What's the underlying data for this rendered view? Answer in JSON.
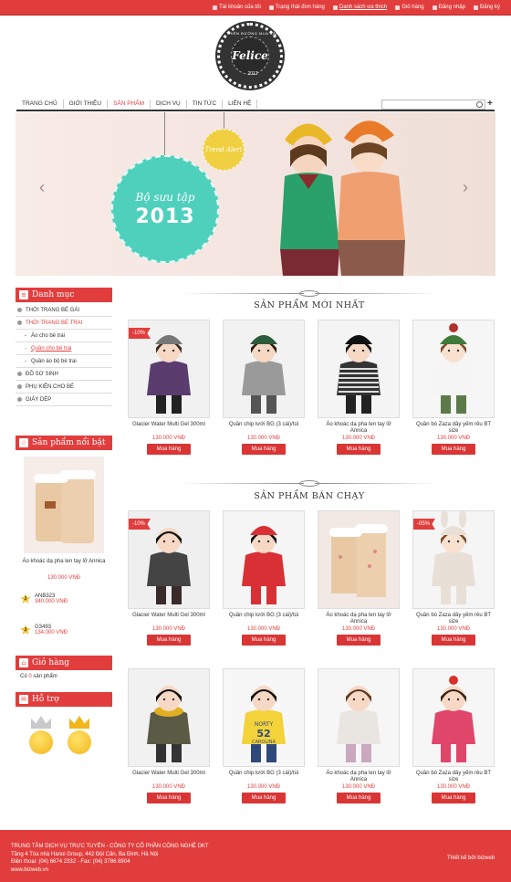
{
  "topbar": {
    "links": [
      "Tài khoản của tôi",
      "Trạng thái đơn hàng",
      "Danh sách ưa thích",
      "Giỏ hàng",
      "Đăng nhập",
      "Đăng ký"
    ],
    "active_index": 2
  },
  "logo": {
    "brand": "Felice",
    "top_text": "THIÊN ĐƯỜNG MUA SẮM",
    "year": "2012"
  },
  "nav": {
    "items": [
      "TRANG CHỦ",
      "GIỚI THIỆU",
      "SẢN PHẨM",
      "DỊCH VỤ",
      "TIN TỨC",
      "LIÊN HỆ"
    ],
    "active_index": 2
  },
  "banner": {
    "circle_line1": "Bộ sưu tập",
    "circle_line2": "2013",
    "tag_text": "Trend Alert"
  },
  "sidebar": {
    "category_title": "Danh mục",
    "categories": [
      {
        "label": "THỜI TRANG BÉ GÁI",
        "level": 0
      },
      {
        "label": "THỜI TRANG BÉ TRAI",
        "level": 0,
        "active": true
      },
      {
        "label": "Áo cho bé trai",
        "level": 1
      },
      {
        "label": "Quần cho bé trai",
        "level": 1,
        "active": true
      },
      {
        "label": "Quần áo bộ bé trai",
        "level": 1
      },
      {
        "label": "ĐỒ SƠ SINH",
        "level": 0
      },
      {
        "label": "PHỤ KIỆN CHO BÉ",
        "level": 0
      },
      {
        "label": "GIÀY DÉP",
        "level": 0
      }
    ],
    "featured_title": "Sản phẩm nổi bật",
    "featured": {
      "name": "Áo khoác dạ pha len tay lỡ Annica",
      "price": "130.000 VNĐ"
    },
    "ranks": [
      {
        "rank": "2",
        "code": "ANB323",
        "price": "340.000 VNĐ"
      },
      {
        "rank": "3",
        "code": "G3493",
        "price": "134.000 VNĐ"
      }
    ],
    "cart_title": "Giỏ hàng",
    "cart_prefix": "Có",
    "cart_count": "0",
    "cart_suffix": "sản phẩm",
    "support_title": "Hỗ trợ"
  },
  "sections": {
    "new_title": "SẢN PHẨM MỚI NHẤT",
    "best_title": "SẢN PHẨM BÁN CHẠY"
  },
  "buy_label": "Mua hàng",
  "new_products": [
    {
      "name": "Glacier Water Multi Gel 300ml",
      "price": "130.000 VNĐ",
      "badge": "-10%"
    },
    {
      "name": "Quần chip lưới BG (3 cái)/túi",
      "price": "130.000 VNĐ",
      "badge": ""
    },
    {
      "name": "Áo khoác dạ pha len tay lỡ Annica",
      "price": "130.000 VNĐ",
      "badge": ""
    },
    {
      "name": "Quần bó Zaza dây yếm rêu BT size",
      "price": "130.000 VNĐ",
      "badge": ""
    }
  ],
  "best_products": [
    {
      "name": "Glacier Water Multi Gel 300ml",
      "price": "130.000 VNĐ",
      "badge": "-10%"
    },
    {
      "name": "Quần chip lưới BG (3 cái)/túi",
      "price": "130.000 VNĐ",
      "badge": ""
    },
    {
      "name": "Áo khoác dạ pha len tay lỡ Annica",
      "price": "130.000 VNĐ",
      "badge": ""
    },
    {
      "name": "Quần bó Zaza dây yếm rêu BT size",
      "price": "130.000 VNĐ",
      "badge": "-05%"
    },
    {
      "name": "Glacier Water Multi Gel 300ml",
      "price": "130.000 VNĐ",
      "badge": ""
    },
    {
      "name": "Quần chip lưới BG (3 cái)/túi",
      "price": "130.000 VNĐ",
      "badge": ""
    },
    {
      "name": "Áo khoác dạ pha len tay lỡ Annica",
      "price": "130.000 VNĐ",
      "badge": ""
    },
    {
      "name": "Quần bó Zaza dây yếm rêu BT size",
      "price": "130.000 VNĐ",
      "badge": ""
    }
  ],
  "shirt_print": {
    "line1": "NORTY",
    "line2": "52",
    "line3": "CAROLINA"
  },
  "footer": {
    "line1": "TRUNG TÂM DỊCH VỤ TRỰC TUYẾN - CÔNG TY CỔ PHẦN CÔNG NGHỆ DKT",
    "line2": "Tầng 4 Tòa nhà Hanoi Group, 442 Đội Cấn, Ba Đình, Hà Nội",
    "line3": "Điện thoại: (04) 6674 2332 - Fax: (04) 3786 8904",
    "line4": "www.bizweb.vn",
    "credit": "Thiết kế bởi bizweb"
  },
  "colors": {
    "accent": "#e23d3d",
    "teal": "#4fd0bd",
    "yellow": "#f0d040"
  }
}
